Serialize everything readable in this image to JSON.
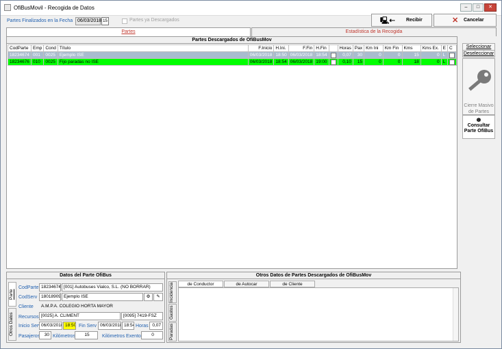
{
  "window": {
    "title": "OfiBusMovil - Recogida de Datos"
  },
  "toolbar": {
    "date_label": "Partes Finalizados en la Fecha",
    "date": "06/03/2018",
    "cal_icon": "calendar-icon",
    "descargados_label": "Partes ya Descargados",
    "recibir": "Recibir",
    "cancelar": "Cancelar"
  },
  "tabs": [
    {
      "label": "Partes"
    },
    {
      "label": "Estadística de la Recogida"
    }
  ],
  "grid": {
    "title": "Partes Descargados de OfiBusMov",
    "columns": [
      "CodParte",
      "Emp",
      "Cond",
      "Título",
      "F.Inicio",
      "H.Ini.",
      "F.Fin",
      "H.Fin",
      "",
      "Horas",
      "Pax",
      "Km Ini",
      "Km Fin",
      "Kms",
      "Kms Ex.",
      "E",
      "C"
    ],
    "rows": [
      {
        "style": "sel",
        "cells": [
          "18234674",
          "001",
          "0025",
          "Ejemplo ISE",
          "06/03/2018",
          "18:50",
          "06/03/2018",
          "18:54",
          "",
          "0,07",
          "30",
          "0",
          "0",
          "15",
          "0",
          "L",
          ""
        ]
      },
      {
        "style": "grn",
        "cells": [
          "18234676",
          "010",
          "0025",
          "Fijo paradas no ISE",
          "06/03/2018",
          "18:54",
          "06/03/2018",
          "19:00",
          "",
          "0,10",
          "15",
          "0",
          "0",
          "18",
          "0",
          "L",
          ""
        ]
      }
    ]
  },
  "side": {
    "seleccionar": "Seleccionar",
    "deseleccionar": "Deseleccionar",
    "cierre": "Cierre Masivo de Partes",
    "consultar": "Consultar Parte OfiBus"
  },
  "datos": {
    "title": "Datos del Parte OfiBus",
    "vtab_parte": "Parte",
    "vtab_otros": "Otros Datos",
    "codparte_lbl": "CodParte",
    "codparte": "18234674",
    "empresa": "[001] Autobuses Vialco, S.L. (NO BORRAR)",
    "codserv_lbl": "CodServ",
    "codserv": "18018909",
    "serv_name": "Ejemplo ISE",
    "cliente_lbl": "Cliente",
    "cliente": "A.M.P.A. COLEGIO HORTA MAYOR",
    "recursos_lbl": "Recursos",
    "conductor": "[0025] A. CLIMENT",
    "vehiculo": "[0095] 7419-FSZ",
    "inicio_lbl": "Inicio Serv",
    "inicio_fecha": "06/03/2018",
    "inicio_hora": "18:50",
    "fin_lbl": "Fin Serv",
    "fin_fecha": "06/03/2018",
    "fin_hora": "18:54",
    "horas_lbl": "Horas",
    "horas": "0,07",
    "pax_lbl": "Pasajeros",
    "pax": "30",
    "km_lbl": "Kilómetros",
    "km": "15",
    "kmex_lbl": "Kilómetros Exentos",
    "kmex": "0"
  },
  "otros": {
    "title": "Otros Datos de Partes Descargados de OfiBusMov",
    "tabs": [
      "de Conductor",
      "de Autocar",
      "de Cliente"
    ],
    "vtabs": [
      "Incidencia",
      "Gastos",
      "Paradas"
    ]
  }
}
